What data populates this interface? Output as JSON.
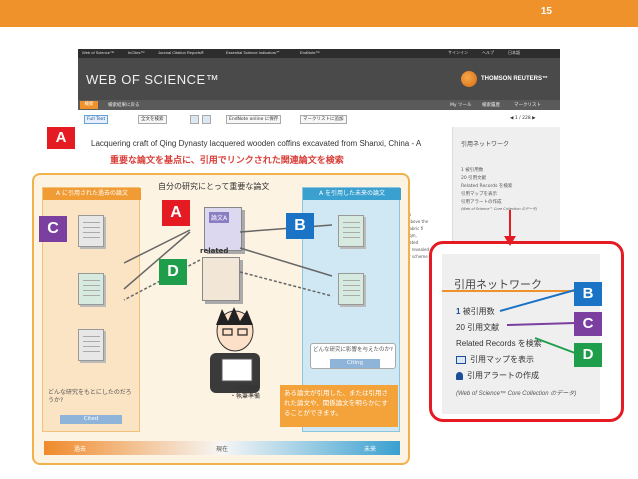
{
  "slide": {
    "number": "15"
  },
  "wos": {
    "topnav": [
      "Web of Science™",
      "InCites™",
      "Journal Citation Reports®",
      "Essential Science Indicators℠",
      "EndNote™"
    ],
    "topnav_right": [
      "サインイン",
      "ヘルプ",
      "日本語"
    ],
    "logo": "WEB OF SCIENCE™",
    "tr_logo": "THOMSON REUTERS™",
    "subnav": {
      "search_tab": "検索",
      "back": "検索結果に戻る",
      "right": [
        "My ツール",
        "検索履歴",
        "マークリスト"
      ]
    },
    "toolbar": {
      "fulltext": "全文を検索",
      "endnote": "EndNote online に保存",
      "marklist": "マークリストに追加",
      "pager": "◀ 1 / 228 ▶"
    },
    "paper_title": "Lacquering craft of Qing Dynasty lacquered wooden coffins excavated from Shanxi, China - A",
    "subtitle": "重要な論文を基点に、引用でリンクされた関連論文を検索",
    "right_panel": {
      "title": "引用ネットワーク",
      "lines": [
        "1 被引用数",
        "20 引用文献",
        "Related Records を検索",
        "引用マップを表示",
        "引用アラートの作成",
        "(Web of Science™ Core Collection のデータ)"
      ]
    },
    "mid_text": [
      "ls",
      "above the",
      "fabric fi",
      "lqm,",
      "lated",
      "y revealed",
      "ir scheme"
    ]
  },
  "diagram": {
    "center_head": "自分の研究にとって重要な論文",
    "past_head": "A に引用された過去の論文",
    "future_head": "A を引用した未来の論文",
    "key_tag": "論文A",
    "related": "related",
    "cited_note": "どんな研究をもとにしたのだろうか?",
    "cited_label": "Cited",
    "citing_note": "どんな研究に影響を与えたのか?",
    "citing_label": "Citing",
    "research_note": "・研究調査\n・執筆準備",
    "orange_box": "ある論文が引用した、または引用された論文や、関係論文を明らかにすることができます。",
    "time": {
      "past": "過去",
      "now": "現在",
      "future": "未来"
    }
  },
  "zoom": {
    "title": "引用ネットワーク",
    "cited_count": "1",
    "cited_label": "被引用数",
    "refs_count": "20",
    "refs_label": "引用文献",
    "related": "Related Records を検索",
    "map": "引用マップを表示",
    "alert": "引用アラートの作成",
    "source": "(Web of Science™ Core Collection のデータ)"
  },
  "labels": {
    "A": "A",
    "B": "B",
    "C": "C",
    "D": "D"
  },
  "colors": {
    "orange": "#f0922b",
    "red": "#e51b23",
    "blue": "#1a73c5",
    "purple": "#7b3fa0",
    "green": "#1e9e4a"
  }
}
